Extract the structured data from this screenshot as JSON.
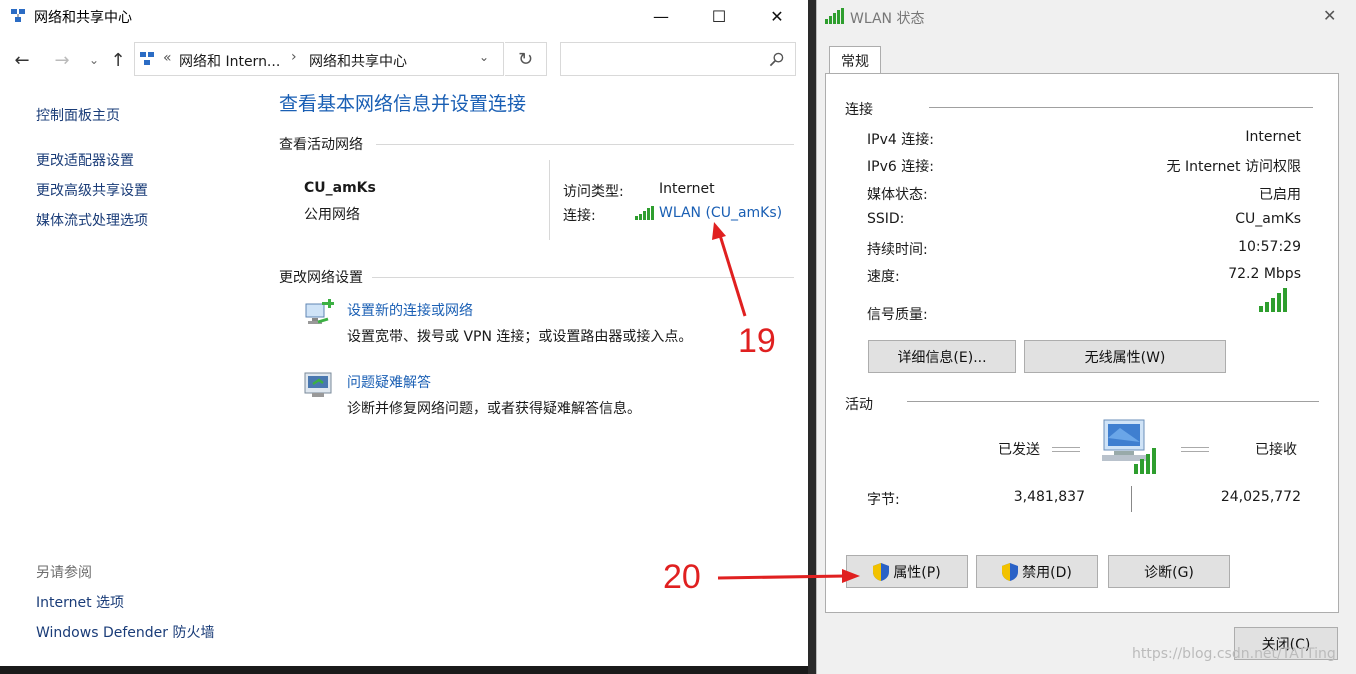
{
  "left_window": {
    "title": "网络和共享中心",
    "caption": {
      "minimize": "—",
      "maximize": "☐",
      "close": "✕"
    },
    "breadcrumb": {
      "chevron": "«",
      "crumb1": "网络和 Intern...",
      "sep": "›",
      "crumb2": "网络和共享中心"
    },
    "sidebar": {
      "items": [
        "控制面板主页",
        "更改适配器设置",
        "更改高级共享设置",
        "媒体流式处理选项"
      ],
      "see_also_title": "另请参阅",
      "see_also": [
        "Internet 选项",
        "Windows Defender 防火墙"
      ]
    },
    "main": {
      "heading": "查看基本网络信息并设置连接",
      "active_title": "查看活动网络",
      "network_name": "CU_amKs",
      "network_type": "公用网络",
      "access_label": "访问类型:",
      "access_value": "Internet",
      "conn_label": "连接:",
      "conn_value": "WLAN (CU_amKs)",
      "change_title": "更改网络设置",
      "task1_link": "设置新的连接或网络",
      "task1_desc": "设置宽带、拨号或 VPN 连接；或设置路由器或接入点。",
      "task2_link": "问题疑难解答",
      "task2_desc": "诊断并修复网络问题，或者获得疑难解答信息。"
    }
  },
  "right_window": {
    "title": "WLAN 状态",
    "close": "✕",
    "tab": "常规",
    "connection": {
      "title": "连接",
      "rows": [
        {
          "label": "IPv4 连接:",
          "value": "Internet"
        },
        {
          "label": "IPv6 连接:",
          "value": "无 Internet 访问权限"
        },
        {
          "label": "媒体状态:",
          "value": "已启用"
        },
        {
          "label": "SSID:",
          "value": "CU_amKs"
        },
        {
          "label": "持续时间:",
          "value": "10:57:29"
        },
        {
          "label": "速度:",
          "value": "72.2 Mbps"
        }
      ],
      "signal_label": "信号质量:",
      "details_button": "详细信息(E)...",
      "wireless_button": "无线属性(W)"
    },
    "activity": {
      "title": "活动",
      "sent_label": "已发送",
      "recv_label": "已接收",
      "bytes_label": "字节:",
      "sent_bytes": "3,481,837",
      "recv_bytes": "24,025,772"
    },
    "buttons": {
      "properties": "属性(P)",
      "disable": "禁用(D)",
      "diagnose": "诊断(G)",
      "close": "关闭(C)"
    }
  },
  "annotations": {
    "step19": "19",
    "step20": "20",
    "arrow_color": "#e02020"
  },
  "watermark": "https://blog.csdn.net/TATTing",
  "colors": {
    "link": "#1a5fb4",
    "heading": "#1a5fb4",
    "signal": "#2e9e2e"
  }
}
